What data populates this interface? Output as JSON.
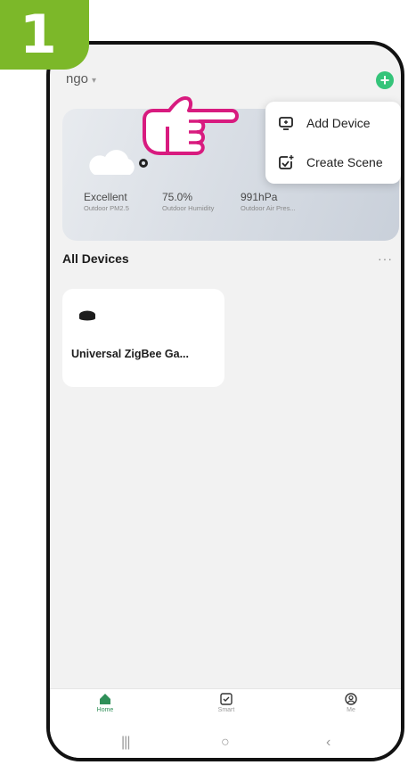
{
  "step": {
    "number": "1",
    "color": "#7cb829"
  },
  "header": {
    "home_name": "ngo",
    "home_caret": "▾",
    "add_icon": "plus-circle-icon",
    "add_symbol": "+",
    "accent": "#35c47a"
  },
  "weather": {
    "icon": "cloud-icon",
    "metrics": [
      {
        "value": "Excellent",
        "label": "Outdoor PM2.5"
      },
      {
        "value": "75.0%",
        "label": "Outdoor Humidity"
      },
      {
        "value": "991hPa",
        "label": "Outdoor Air Pres..."
      }
    ]
  },
  "menu": {
    "items": [
      {
        "label": "Add Device",
        "icon": "add-device-icon"
      },
      {
        "label": "Create Scene",
        "icon": "create-scene-icon"
      }
    ]
  },
  "pointer": {
    "icon": "pointing-hand-icon",
    "color": "#d81b7f"
  },
  "devices": {
    "title": "All Devices",
    "more": "···",
    "items": [
      {
        "name": "Universal ZigBee Ga...",
        "icon": "zigbee-gateway-icon"
      }
    ]
  },
  "bottom_nav": {
    "items": [
      {
        "label": "Home",
        "icon": "home-icon",
        "active": true
      },
      {
        "label": "Smart",
        "icon": "smart-icon",
        "active": false
      },
      {
        "label": "Me",
        "icon": "me-icon",
        "active": false
      }
    ]
  },
  "system_nav": {
    "recents": "|||",
    "home": "○",
    "back": "‹"
  }
}
